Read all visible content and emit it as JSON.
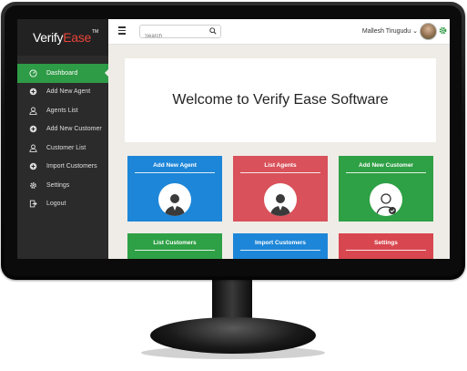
{
  "app": {
    "logo_main": "Verify",
    "logo_accent": "Ease",
    "logo_tm": "TM"
  },
  "sidebar": {
    "items": [
      {
        "label": "Dashboard",
        "icon": "dashboard-icon",
        "active": true
      },
      {
        "label": "Add New Agent",
        "icon": "plus-circle-icon"
      },
      {
        "label": "Agents List",
        "icon": "user-icon"
      },
      {
        "label": "Add New Customer",
        "icon": "plus-circle-icon"
      },
      {
        "label": "Customer List",
        "icon": "user-icon"
      },
      {
        "label": "Import Customers",
        "icon": "plus-circle-icon"
      },
      {
        "label": "Settings",
        "icon": "gear-icon"
      },
      {
        "label": "Logout",
        "icon": "logout-icon"
      }
    ]
  },
  "topbar": {
    "search_placeholder": "Search",
    "user_name": "Mallesh Tirugudu",
    "user_caret": "⌄"
  },
  "main": {
    "welcome": "Welcome to Verify Ease Software",
    "tiles": [
      {
        "label": "Add New Agent",
        "color": "#1d86d8"
      },
      {
        "label": "List Agents",
        "color": "#d9515a"
      },
      {
        "label": "Add New Customer",
        "color": "#2ea045"
      },
      {
        "label": "List Customers",
        "color": "#2ea045"
      },
      {
        "label": "Import Customers",
        "color": "#1d86d8"
      },
      {
        "label": "Settings",
        "color": "#d8474f"
      }
    ]
  },
  "colors": {
    "sidebar_bg": "#2b2b2b",
    "active_green": "#2e9b46",
    "content_bg": "#efece7"
  }
}
